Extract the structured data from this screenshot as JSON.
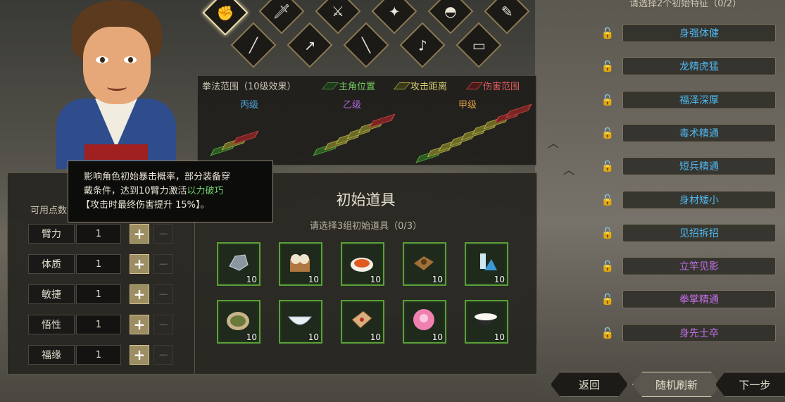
{
  "weapons": [
    {
      "icon": "fist-icon",
      "glyph": "✊",
      "selected": true
    },
    {
      "icon": "sword-icon",
      "glyph": "🗡"
    },
    {
      "icon": "blade-icon",
      "glyph": "⚔"
    },
    {
      "icon": "dart-icon",
      "glyph": "✦"
    },
    {
      "icon": "fan-icon",
      "glyph": "◓"
    },
    {
      "icon": "brush-icon",
      "glyph": "✎"
    },
    {
      "icon": "staff-icon",
      "glyph": "╱"
    },
    {
      "icon": "spear-icon",
      "glyph": "↗"
    },
    {
      "icon": "flute-icon",
      "glyph": "╲"
    },
    {
      "icon": "pipa-icon",
      "glyph": "♪"
    },
    {
      "icon": "scroll-icon",
      "glyph": "▭"
    }
  ],
  "range": {
    "header": "拳法范围（10级效果）",
    "legend": [
      {
        "label": "主角位置",
        "color": "#4a8a3a"
      },
      {
        "label": "攻击距离",
        "color": "#8a8a3a"
      },
      {
        "label": "伤害范围",
        "color": "#a83a3a"
      }
    ],
    "grades": [
      {
        "label": "丙级",
        "color": "#4fa8e0"
      },
      {
        "label": "乙级",
        "color": "#b066d8"
      },
      {
        "label": "甲级",
        "color": "#e0a040"
      }
    ]
  },
  "stats": {
    "available_label": "可用点数",
    "items": [
      {
        "label": "臂力",
        "value": "1"
      },
      {
        "label": "体质",
        "value": "1"
      },
      {
        "label": "敏捷",
        "value": "1"
      },
      {
        "label": "悟性",
        "value": "1"
      },
      {
        "label": "福缘",
        "value": "1"
      }
    ],
    "plus": "+",
    "minus": "−"
  },
  "tooltip": {
    "line1": "影响角色初始暴击概率，部分装备穿",
    "line2_a": "戴条件，达到10臂力激活",
    "line2_b": "以力破巧",
    "line3": "【攻击时最终伤害提升 15%】。"
  },
  "items": {
    "title": "初始道具",
    "subtitle": "请选择3组初始道具（0/3）",
    "list": [
      {
        "icon": "ore-icon",
        "qty": "10"
      },
      {
        "icon": "steamed-bun-icon",
        "qty": "10"
      },
      {
        "icon": "dish-icon",
        "qty": "10"
      },
      {
        "icon": "herb-pack-icon",
        "qty": "10"
      },
      {
        "icon": "potion-icon",
        "qty": "10"
      },
      {
        "icon": "herb-plate-icon",
        "qty": "10"
      },
      {
        "icon": "bowl-icon",
        "qty": "10"
      },
      {
        "icon": "cake-box-icon",
        "qty": "10"
      },
      {
        "icon": "pink-bun-icon",
        "qty": "10"
      },
      {
        "icon": "rice-bowl-icon",
        "qty": "10"
      }
    ]
  },
  "traits": {
    "header": "请选择2个初始特征（0/2）",
    "list": [
      {
        "label": "身强体健",
        "color": "#4fb8f0"
      },
      {
        "label": "龙精虎猛",
        "color": "#4fb8f0"
      },
      {
        "label": "福泽深厚",
        "color": "#4fb8f0"
      },
      {
        "label": "毒术精通",
        "color": "#4fb8f0"
      },
      {
        "label": "短兵精通",
        "color": "#4fb8f0"
      },
      {
        "label": "身材矮小",
        "color": "#4fb8f0"
      },
      {
        "label": "见招拆招",
        "color": "#4fb8f0"
      },
      {
        "label": "立竿见影",
        "color": "#c070e8"
      },
      {
        "label": "拳掌精通",
        "color": "#c070e8"
      },
      {
        "label": "身先士卒",
        "color": "#c070e8"
      }
    ]
  },
  "buttons": {
    "back": "返回",
    "refresh": "随机刷新",
    "next": "下一步"
  }
}
